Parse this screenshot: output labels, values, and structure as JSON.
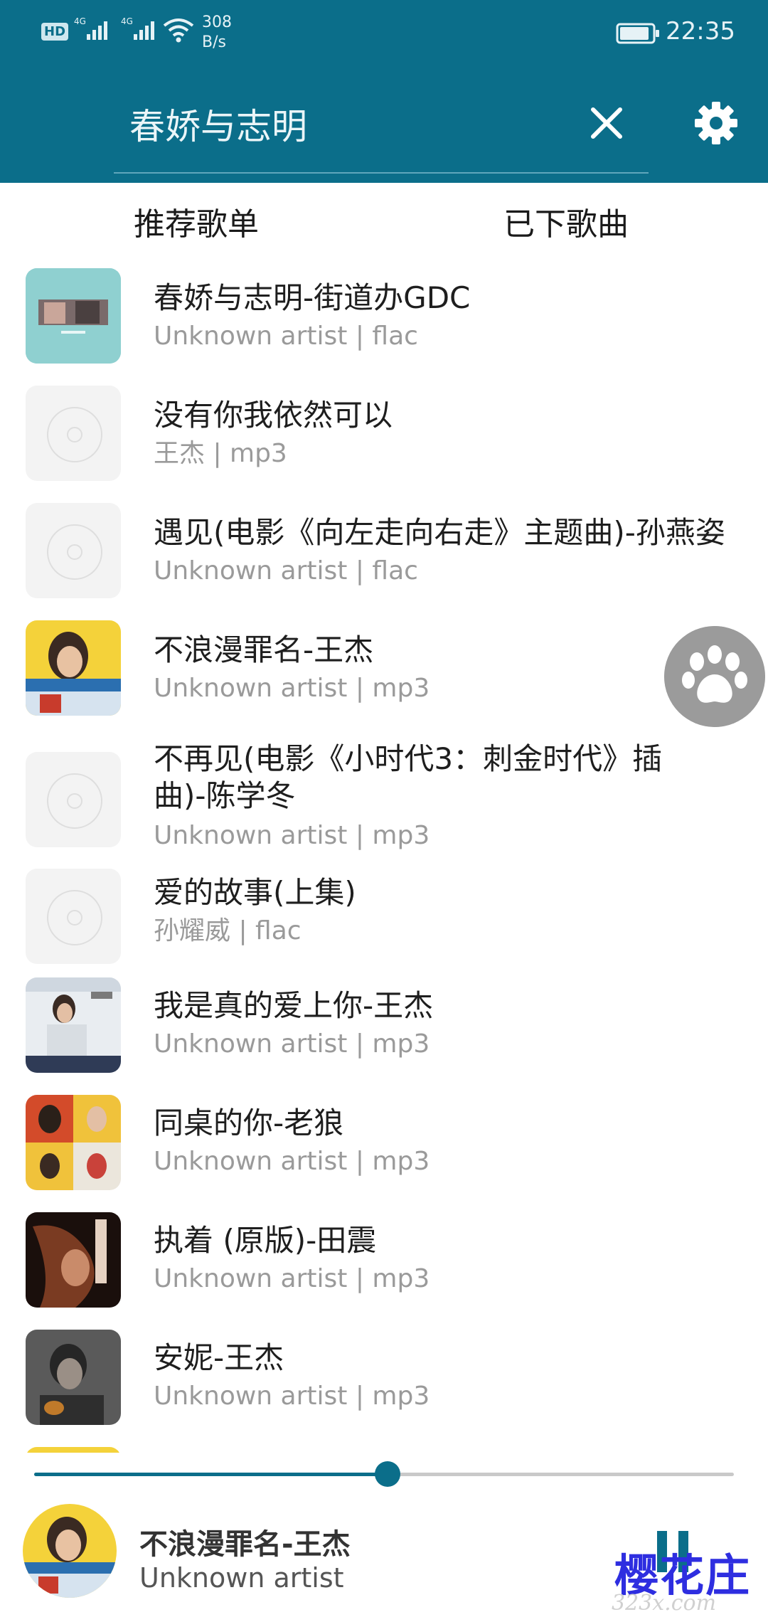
{
  "status_bar": {
    "hd": "HD",
    "network1": "4G",
    "network2": "4G",
    "speed_value": "308",
    "speed_unit": "B/s",
    "time": "22:35"
  },
  "toolbar": {
    "search_text": "春娇与志明"
  },
  "tabs": [
    "推荐歌单",
    "已下歌曲"
  ],
  "songs": [
    {
      "title": "春娇与志明-街道办GDC",
      "subtitle": "Unknown artist | flac"
    },
    {
      "title": "没有你我依然可以",
      "subtitle": "王杰 | mp3"
    },
    {
      "title": "遇见(电影《向左走向右走》主题曲)-孙燕姿",
      "subtitle": "Unknown artist | flac"
    },
    {
      "title": "不浪漫罪名-王杰",
      "subtitle": "Unknown artist | mp3"
    },
    {
      "title": "不再见(电影《小时代3：刺金时代》插",
      "title2": "曲)-陈学冬",
      "subtitle": "Unknown artist | mp3"
    },
    {
      "title": "爱的故事(上集)",
      "subtitle": "孙耀威 | flac"
    },
    {
      "title": "我是真的爱上你-王杰",
      "subtitle": "Unknown artist | mp3"
    },
    {
      "title": "同桌的你-老狼",
      "subtitle": "Unknown artist | mp3"
    },
    {
      "title": "执着 (原版)-田震",
      "subtitle": "Unknown artist | mp3"
    },
    {
      "title": "安妮-王杰",
      "subtitle": "Unknown artist | mp3"
    }
  ],
  "player": {
    "title": "不浪漫罪名-王杰",
    "artist": "Unknown artist",
    "progress_fraction": 0.505
  },
  "watermark": {
    "text": "樱花庄",
    "sub": "323x.com"
  },
  "colors": {
    "primary": "#0b6e8a",
    "paw_bg": "#9b9b9b",
    "watermark": "#2e2ee0"
  },
  "icons": {
    "close": "close-icon",
    "settings": "gear-icon",
    "paw": "paw-icon",
    "pause": "pause-icon"
  }
}
